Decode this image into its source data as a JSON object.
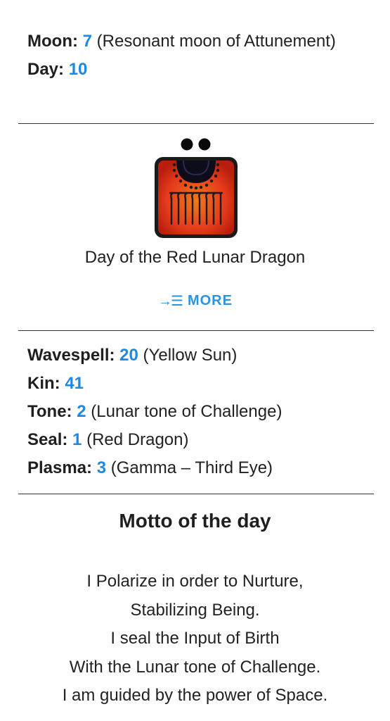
{
  "calendar": {
    "moon_label": "Moon:",
    "moon_value": "7",
    "moon_desc": "(Resonant moon of Attunement)",
    "day_label": "Day:",
    "day_value": "10"
  },
  "kin": {
    "dots": 2,
    "title": "Day of the Red Lunar Dragon",
    "more_icon": "→☰",
    "more_label": "MORE"
  },
  "details": {
    "wavespell_label": "Wavespell:",
    "wavespell_value": "20",
    "wavespell_desc": "(Yellow Sun)",
    "kin_label": "Kin:",
    "kin_value": "41",
    "tone_label": "Tone:",
    "tone_value": "2",
    "tone_desc": "(Lunar tone of Challenge)",
    "seal_label": "Seal:",
    "seal_value": "1",
    "seal_desc": "(Red Dragon)",
    "plasma_label": "Plasma:",
    "plasma_value": "3",
    "plasma_desc": "(Gamma – Third Eye)"
  },
  "motto": {
    "heading": "Motto of the day",
    "lines": [
      "I Polarize in order to Nurture,",
      "Stabilizing Being.",
      "I seal the Input of Birth",
      "With the Lunar tone of Challenge.",
      "I am guided by the power of Space."
    ]
  },
  "colors": {
    "accent": "#1e88e5",
    "seal_red": "#e53a1c",
    "seal_dark": "#1a1a1a"
  }
}
